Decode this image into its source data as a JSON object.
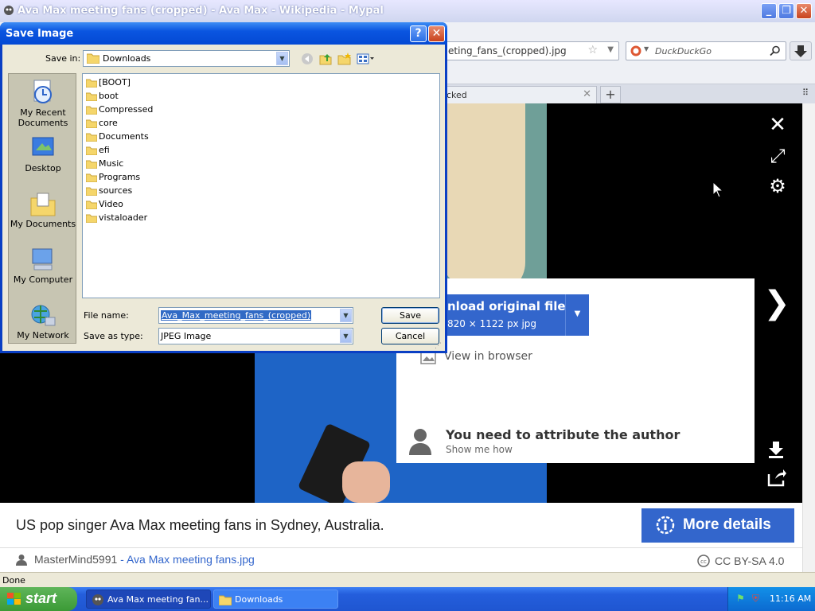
{
  "window": {
    "title": "Ava Max meeting fans (cropped) - Ava Max - Wikipedia - Mypal"
  },
  "browser": {
    "url_fragment": "eting_fans_(cropped).jpg",
    "search_placeholder": "DuckDuckGo",
    "tab_label": "cked",
    "new_tab_label": "+"
  },
  "viewer": {
    "download_label": "nload original file",
    "download_size": "820 × 1122 px jpg",
    "view_in_browser": "View in browser",
    "attribution_title": "You need to attribute the author",
    "attribution_sub": "Show me how",
    "caption": "US pop singer Ava Max meeting fans in Sydney, Australia.",
    "more_details": "More details",
    "author": "MasterMind5991",
    "credit_separator": " - ",
    "file_link": "Ava Max meeting fans.jpg",
    "license": "CC BY-SA 4.0"
  },
  "status": {
    "text": "Done"
  },
  "dialog": {
    "title": "Save Image",
    "help_label": "?",
    "close_label": "✕",
    "save_in_label": "Save in:",
    "save_in_value": "Downloads",
    "places": [
      {
        "label": "My Recent Documents"
      },
      {
        "label": "Desktop"
      },
      {
        "label": "My Documents"
      },
      {
        "label": "My Computer"
      },
      {
        "label": "My Network"
      }
    ],
    "files": [
      "[BOOT]",
      "boot",
      "Compressed",
      "core",
      "Documents",
      "efi",
      "Music",
      "Programs",
      "sources",
      "Video",
      "vistaloader"
    ],
    "file_name_label": "File name:",
    "file_name_value": "Ava_Max_meeting_fans_(cropped)",
    "save_as_label": "Save as type:",
    "save_as_value": "JPEG Image",
    "save_button": "Save",
    "cancel_button": "Cancel"
  },
  "taskbar": {
    "start_label": "start",
    "items": [
      {
        "label": "Ava Max meeting fan..."
      },
      {
        "label": "Downloads"
      }
    ],
    "clock": "11:16 AM"
  },
  "colors": {
    "xp_blue": "#0a55e0",
    "wiki_blue": "#3366cc",
    "dialog_bg": "#ece9d8"
  }
}
